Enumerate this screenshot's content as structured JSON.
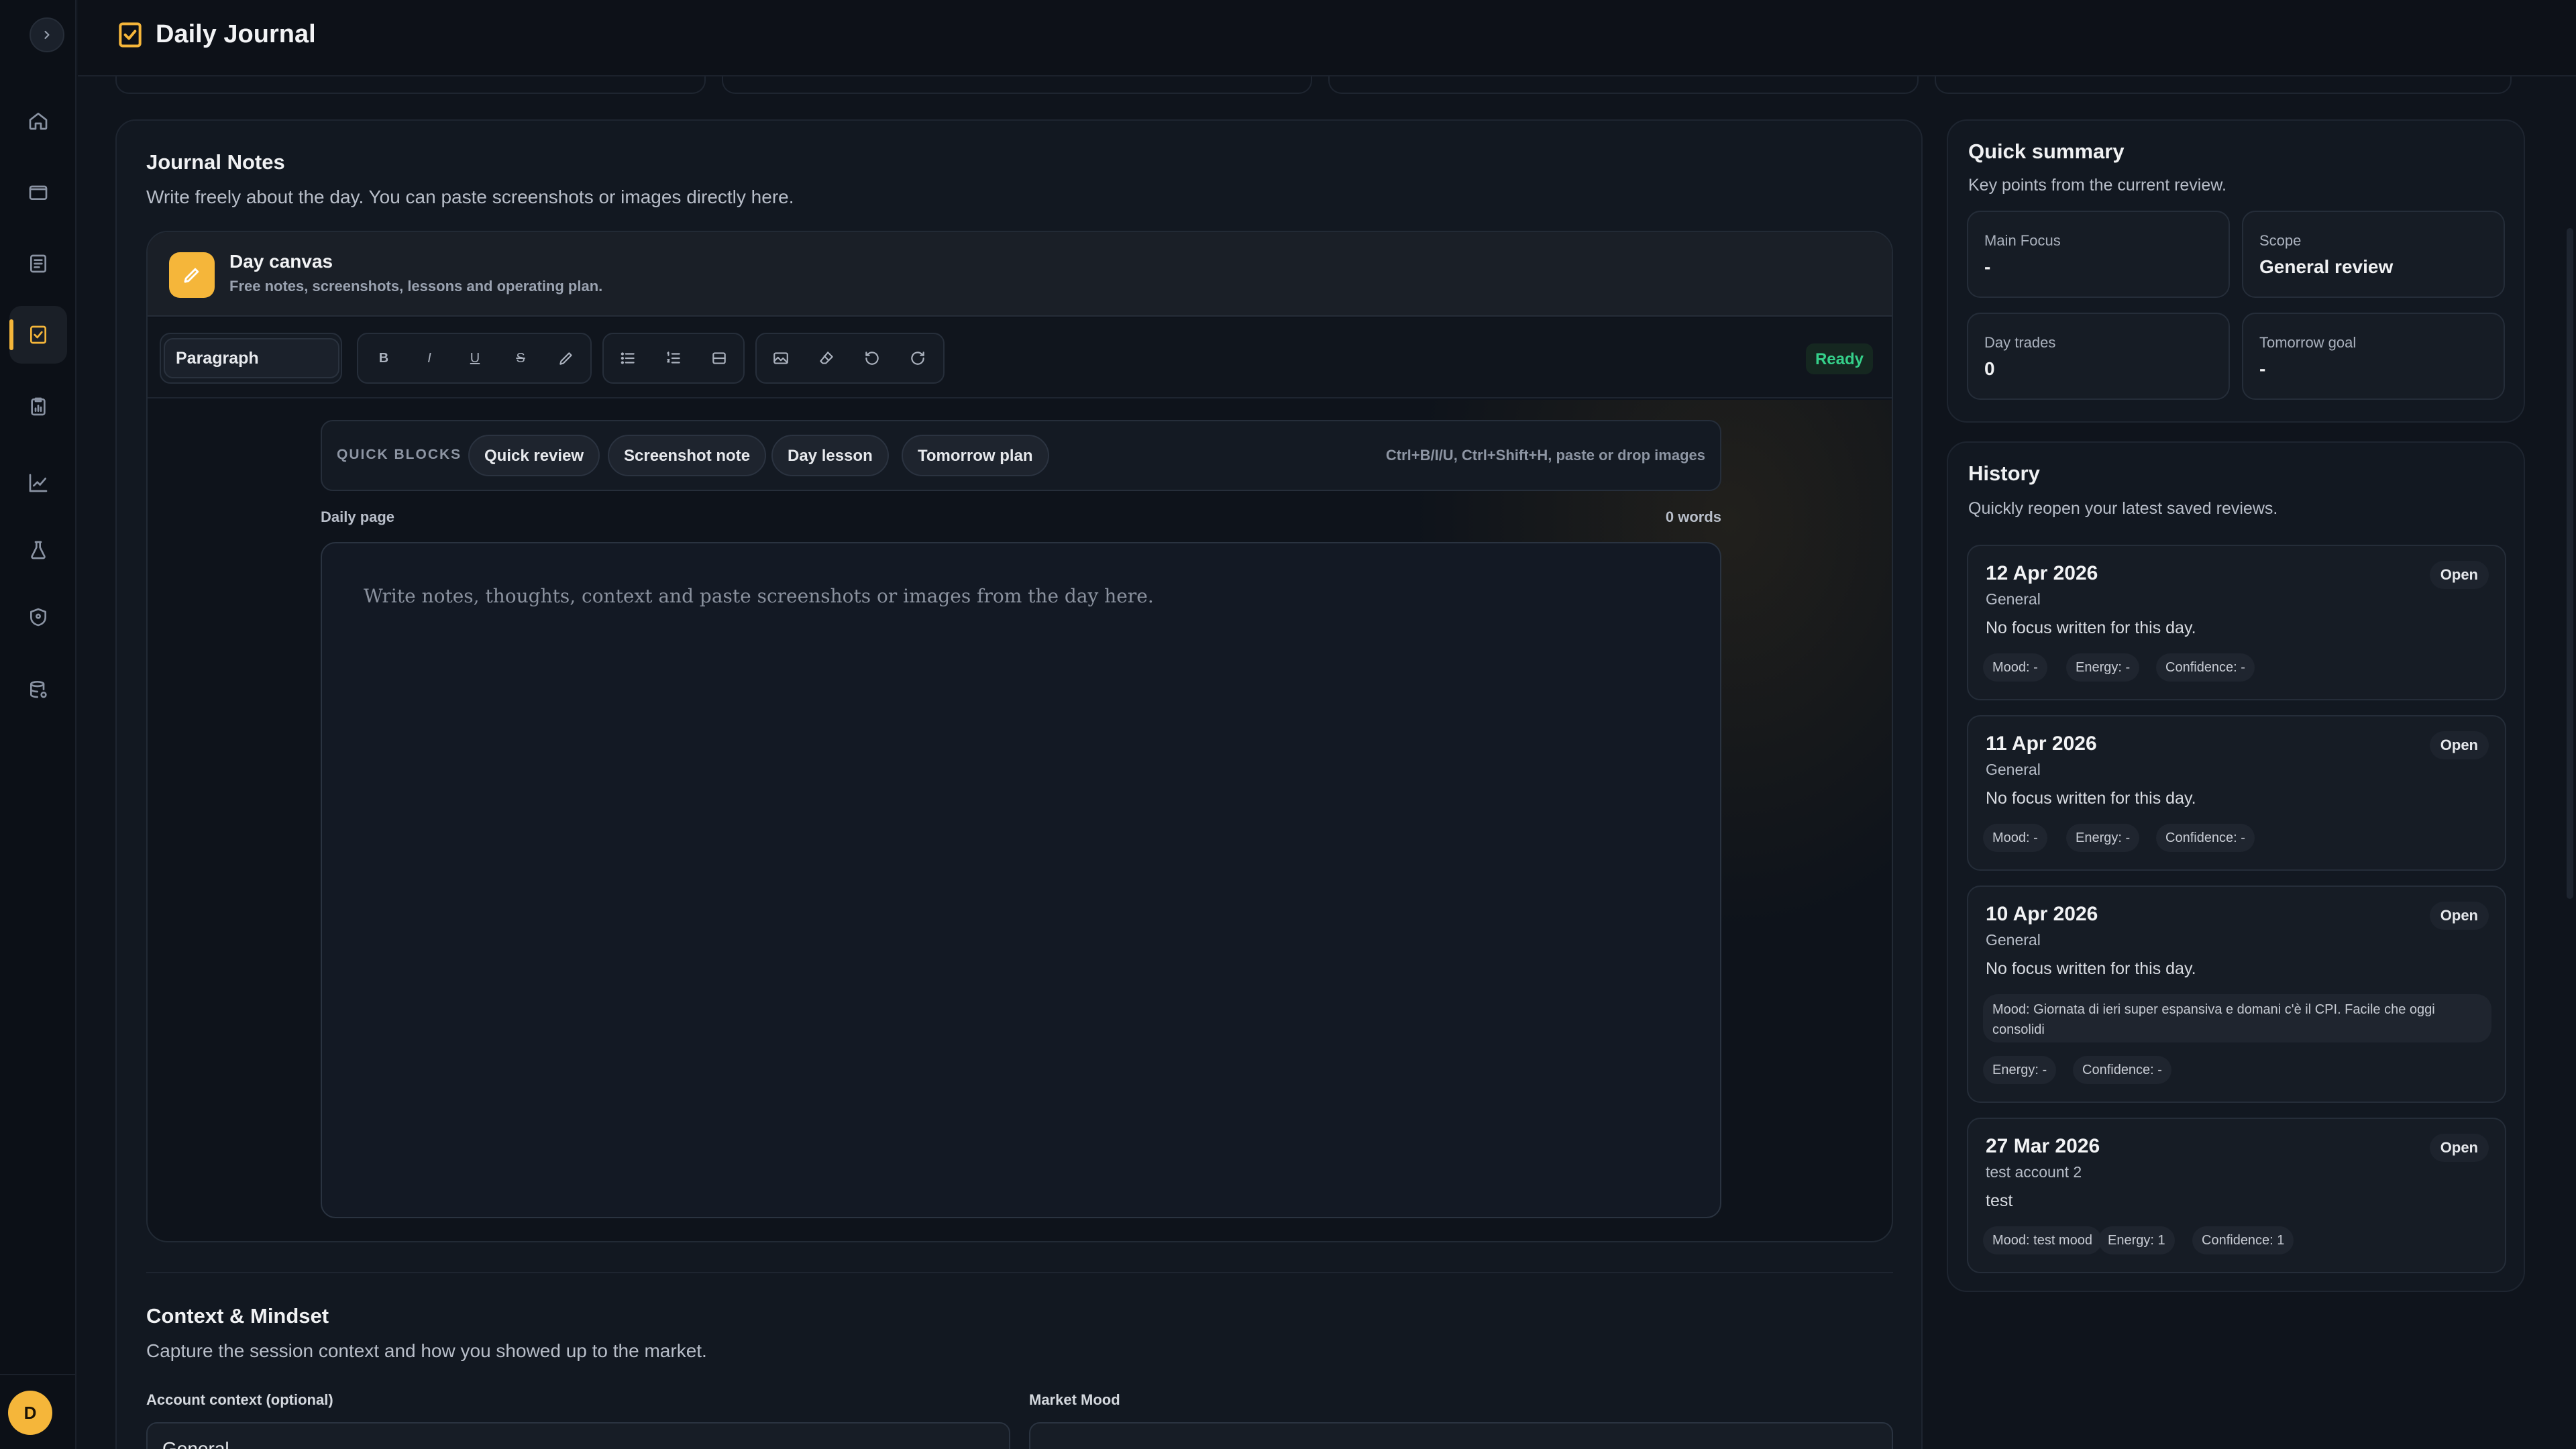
{
  "header": {
    "title": "Daily Journal",
    "icon": "journal-check-icon"
  },
  "sidebar": {
    "toggle_icon": "chevron-right-icon",
    "items": [
      {
        "name": "home",
        "icon": "home-icon"
      },
      {
        "name": "folder",
        "icon": "folder-icon"
      },
      {
        "name": "notes",
        "icon": "notebook-icon"
      },
      {
        "name": "journal",
        "icon": "checklist-icon",
        "active": true
      },
      {
        "name": "reports",
        "icon": "clipboard-chart-icon"
      },
      {
        "name": "analytics",
        "icon": "trend-chart-icon"
      },
      {
        "name": "lab",
        "icon": "flask-icon"
      },
      {
        "name": "security",
        "icon": "shield-icon"
      },
      {
        "name": "data",
        "icon": "database-icon"
      }
    ],
    "avatar_initial": "D"
  },
  "accent_color": "#f5b63a",
  "journal_notes": {
    "title": "Journal Notes",
    "subtitle": "Write freely about the day. You can paste screenshots or images directly here.",
    "canvas": {
      "title": "Day canvas",
      "subtitle": "Free notes, screenshots, lessons and operating plan."
    },
    "toolbar": {
      "block_type": "Paragraph",
      "status": "Ready"
    },
    "quick_blocks": {
      "label": "QUICK BLOCKS",
      "items": [
        "Quick review",
        "Screenshot note",
        "Day lesson",
        "Tomorrow plan"
      ],
      "hint": "Ctrl+B/I/U, Ctrl+Shift+H, paste or drop images"
    },
    "editor": {
      "label": "Daily page",
      "word_count": "0 words",
      "placeholder": "Write notes, thoughts, context and paste screenshots or images from the day here."
    }
  },
  "context": {
    "title": "Context & Mindset",
    "subtitle": "Capture the session context and how you showed up to the market.",
    "account_label": "Account context (optional)",
    "account_value": "General",
    "mood_label": "Market Mood"
  },
  "summary": {
    "title": "Quick summary",
    "subtitle": "Key points from the current review.",
    "stats": [
      {
        "label": "Main Focus",
        "value": "-"
      },
      {
        "label": "Scope",
        "value": "General review"
      },
      {
        "label": "Day trades",
        "value": "0"
      },
      {
        "label": "Tomorrow goal",
        "value": "-"
      }
    ]
  },
  "history": {
    "title": "History",
    "subtitle": "Quickly reopen your latest saved reviews.",
    "open_label": "Open",
    "entries": [
      {
        "date": "12 Apr 2026",
        "scope": "General",
        "focus": "No focus written for this day.",
        "mood": "Mood: -",
        "energy": "Energy: -",
        "confidence": "Confidence: -"
      },
      {
        "date": "11 Apr 2026",
        "scope": "General",
        "focus": "No focus written for this day.",
        "mood": "Mood: -",
        "energy": "Energy: -",
        "confidence": "Confidence: -"
      },
      {
        "date": "10 Apr 2026",
        "scope": "General",
        "focus": "No focus written for this day.",
        "mood": "Mood: Giornata di ieri super espansiva e domani c'è il CPI. Facile che oggi consolidi",
        "energy": "Energy: -",
        "confidence": "Confidence: -"
      },
      {
        "date": "27 Mar 2026",
        "scope": "test account 2",
        "focus": "test",
        "mood": "Mood: test mood",
        "energy": "Energy: 1",
        "confidence": "Confidence: 1"
      }
    ]
  }
}
